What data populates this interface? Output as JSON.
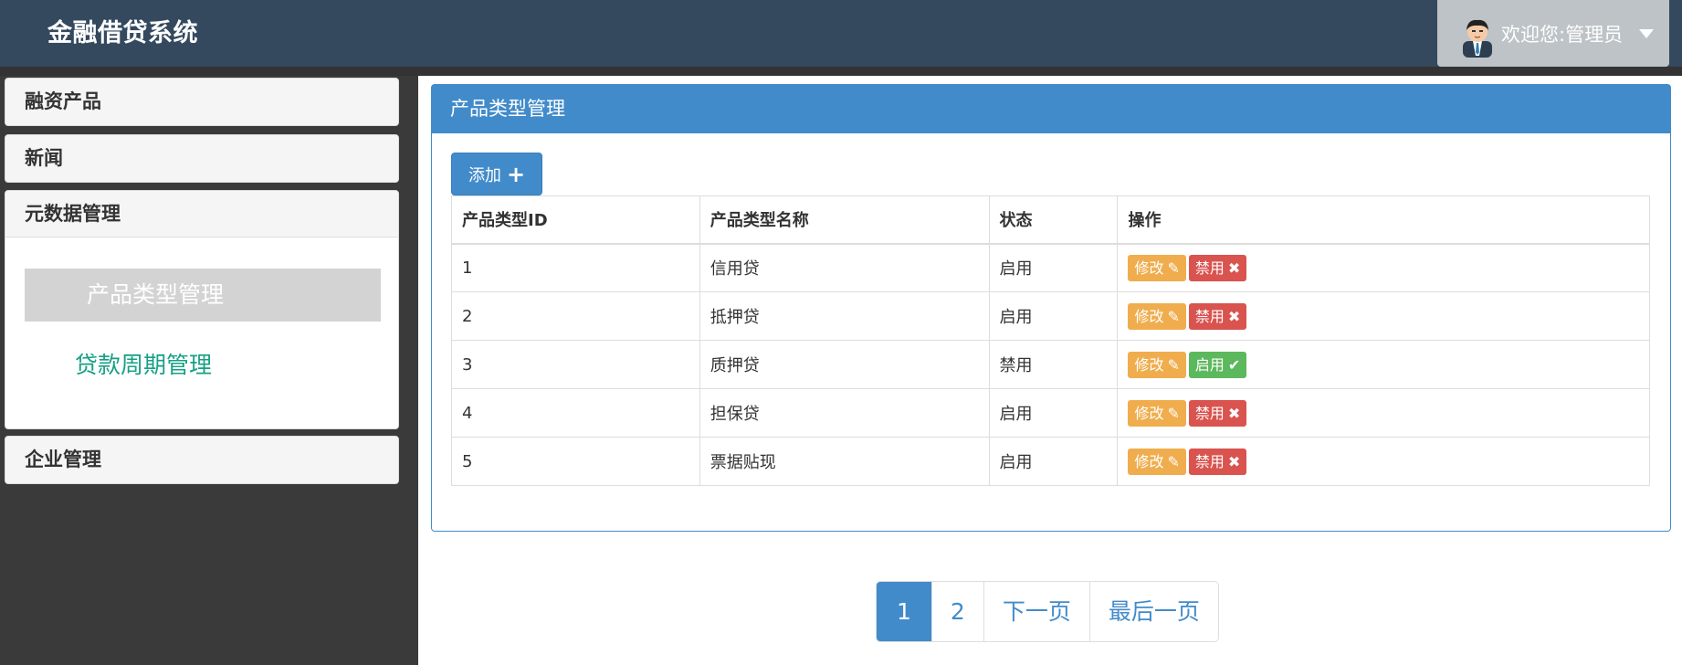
{
  "header": {
    "brand": "金融借贷系统",
    "user_label": "欢迎您:管理员",
    "avatar_icon": "user-avatar-icon",
    "caret_icon": "caret-down-icon"
  },
  "sidebar": {
    "panels": [
      {
        "label": "融资产品"
      },
      {
        "label": "新闻"
      },
      {
        "label": "元数据管理",
        "children": [
          {
            "label": "产品类型管理",
            "active": true
          },
          {
            "label": "贷款周期管理",
            "active": false
          }
        ]
      },
      {
        "label": "企业管理"
      }
    ]
  },
  "main": {
    "title": "产品类型管理",
    "add_label": "添加",
    "add_icon": "plus-icon",
    "table": {
      "headers": [
        "产品类型ID",
        "产品类型名称",
        "状态",
        "操作"
      ],
      "rows": [
        {
          "id": "1",
          "name": "信用贷",
          "status": "启用",
          "edit": "修改",
          "toggle": "禁用"
        },
        {
          "id": "2",
          "name": "抵押贷",
          "status": "启用",
          "edit": "修改",
          "toggle": "禁用"
        },
        {
          "id": "3",
          "name": "质押贷",
          "status": "禁用",
          "edit": "修改",
          "toggle": "启用"
        },
        {
          "id": "4",
          "name": "担保贷",
          "status": "启用",
          "edit": "修改",
          "toggle": "禁用"
        },
        {
          "id": "5",
          "name": "票据贴现",
          "status": "启用",
          "edit": "修改",
          "toggle": "禁用"
        }
      ]
    }
  },
  "pagination": {
    "pages": [
      "1",
      "2"
    ],
    "current": "1",
    "next": "下一页",
    "last": "最后一页"
  },
  "colors": {
    "header_bg": "#34495e",
    "primary": "#428bca",
    "warning": "#f0ad4e",
    "danger": "#d9534f",
    "success": "#5cb85c",
    "link": "#16a085"
  }
}
